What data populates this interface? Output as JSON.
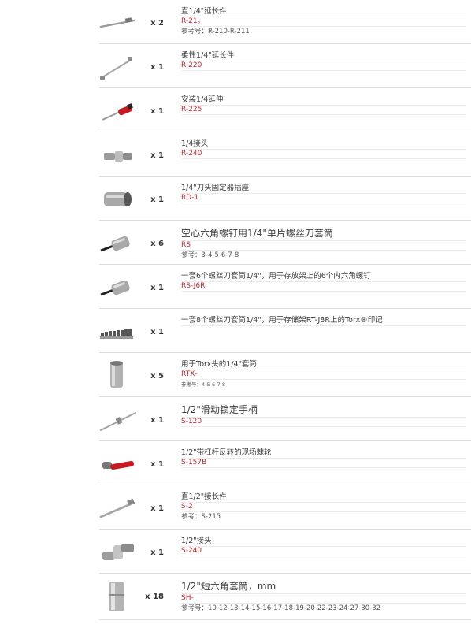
{
  "items": [
    {
      "icon": "extension-bar-icon",
      "qty": "x 2",
      "name": "直1/4\"延长件",
      "code": "R-21。",
      "ref": "参考号：R-210-R-211"
    },
    {
      "icon": "flexible-extension-icon",
      "qty": "x 1",
      "name": "柔性1/4\"延长件",
      "code": "R-220",
      "ref": ""
    },
    {
      "icon": "screwdriver-handle-icon",
      "qty": "x 1",
      "name": "安装1/4延伸",
      "code": "R-225",
      "ref": ""
    },
    {
      "icon": "universal-joint-icon",
      "qty": "x 1",
      "name": "1/4接头",
      "code": "R-240",
      "ref": ""
    },
    {
      "icon": "bit-holder-socket-icon",
      "qty": "x 1",
      "name": "1/4\"刀头固定器插座",
      "code": "RD-1",
      "ref": ""
    },
    {
      "icon": "hex-bit-socket-icon",
      "qty": "x 6",
      "name": "空心六角螺钉用1/4\"单片螺丝刀套筒",
      "code": "RS",
      "ref": "参考：3-4-5-6-7-8"
    },
    {
      "icon": "hex-bit-socket-icon",
      "qty": "x 1",
      "name": "一套6个螺丝刀套筒1/4\"，用于存放架上的6个内六角螺钉",
      "code": "RS-J6R",
      "ref": ""
    },
    {
      "icon": "torx-bit-set-icon",
      "qty": "x 1",
      "name": "一套8个螺丝刀套筒1/4\"，用于存储架RT-J8R上的Torx®印记",
      "code": "",
      "ref": ""
    },
    {
      "icon": "torx-socket-icon",
      "qty": "x 5",
      "name": "用于Torx头的1/4\"套筒",
      "code": "RTX-",
      "ref": "参考号：4-5-6-7-8"
    },
    {
      "icon": "sliding-t-handle-icon",
      "qty": "x 1",
      "name": "1/2\"滑动锁定手柄",
      "code": "S-120",
      "ref": ""
    },
    {
      "icon": "ratchet-icon",
      "qty": "x 1",
      "name": "1/2\"带杠杆反转的现场棘轮",
      "code": "S-157B",
      "ref": ""
    },
    {
      "icon": "extension-bar-icon",
      "qty": "x 1",
      "name": "直1/2\"接长件",
      "code": "S-2",
      "ref": "参考：S-215"
    },
    {
      "icon": "universal-joint-icon",
      "qty": "x 1",
      "name": "1/2\"接头",
      "code": "S-240",
      "ref": ""
    },
    {
      "icon": "hex-socket-icon",
      "qty": "x 18",
      "name": "1/2\"短六角套筒，mm",
      "code": "SH-",
      "ref": "参考号：10-12-13-14-15-16-17-18-19-20-22-23-24-27-30-32"
    }
  ],
  "colors": {
    "code_red": "#c0262c",
    "rule_gray": "#dcdcdc"
  }
}
